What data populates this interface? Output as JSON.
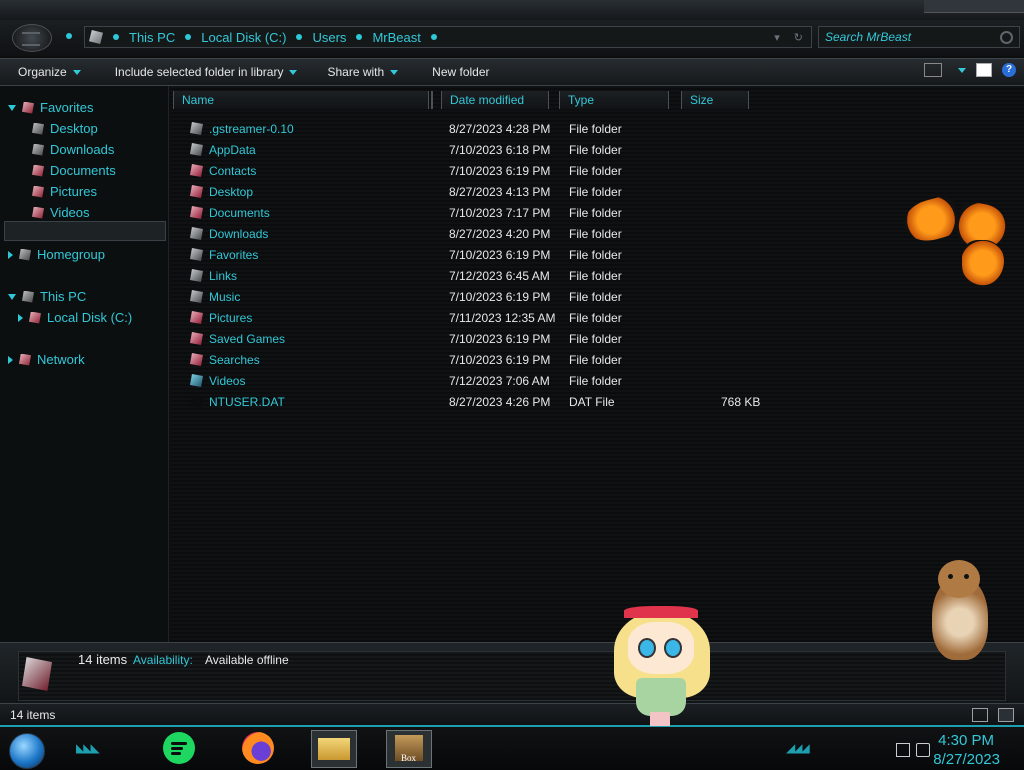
{
  "address": {
    "breadcrumbs": [
      "This PC",
      "Local Disk (C:)",
      "Users",
      "MrBeast"
    ],
    "search_placeholder": "Search MrBeast"
  },
  "toolbar": {
    "organize": "Organize",
    "include_library": "Include selected folder in library",
    "share_with": "Share with",
    "new_folder": "New folder"
  },
  "nav": {
    "favorites": "Favorites",
    "favorites_items": [
      "Desktop",
      "Downloads",
      "Documents",
      "Pictures",
      "Videos"
    ],
    "homegroup": "Homegroup",
    "this_pc": "This PC",
    "local_disk": "Local Disk (C:)",
    "network": "Network"
  },
  "columns": {
    "name": "Name",
    "date_modified": "Date modified",
    "type": "Type",
    "size": "Size"
  },
  "files": [
    {
      "name": ".gstreamer-0.10",
      "date": "8/27/2023 4:28 PM",
      "type": "File folder",
      "size": ""
    },
    {
      "name": "AppData",
      "date": "7/10/2023 6:18 PM",
      "type": "File folder",
      "size": ""
    },
    {
      "name": "Contacts",
      "date": "7/10/2023 6:19 PM",
      "type": "File folder",
      "size": ""
    },
    {
      "name": "Desktop",
      "date": "8/27/2023 4:13 PM",
      "type": "File folder",
      "size": ""
    },
    {
      "name": "Documents",
      "date": "7/10/2023 7:17 PM",
      "type": "File folder",
      "size": ""
    },
    {
      "name": "Downloads",
      "date": "8/27/2023 4:20 PM",
      "type": "File folder",
      "size": ""
    },
    {
      "name": "Favorites",
      "date": "7/10/2023 6:19 PM",
      "type": "File folder",
      "size": ""
    },
    {
      "name": "Links",
      "date": "7/12/2023 6:45 AM",
      "type": "File folder",
      "size": ""
    },
    {
      "name": "Music",
      "date": "7/10/2023 6:19 PM",
      "type": "File folder",
      "size": ""
    },
    {
      "name": "Pictures",
      "date": "7/11/2023 12:35 AM",
      "type": "File folder",
      "size": ""
    },
    {
      "name": "Saved Games",
      "date": "7/10/2023 6:19 PM",
      "type": "File folder",
      "size": ""
    },
    {
      "name": "Searches",
      "date": "7/10/2023 6:19 PM",
      "type": "File folder",
      "size": ""
    },
    {
      "name": "Videos",
      "date": "7/12/2023 7:06 AM",
      "type": "File folder",
      "size": ""
    },
    {
      "name": "NTUSER.DAT",
      "date": "8/27/2023 4:26 PM",
      "type": "DAT File",
      "size": "768 KB"
    }
  ],
  "details": {
    "count": "14 items",
    "availability_label": "Availability:",
    "availability_value": "Available offline"
  },
  "status": {
    "count": "14 items"
  },
  "taskbar": {
    "box_label": "Box",
    "time": "4:30 PM",
    "date": "8/27/2023"
  },
  "colors": {
    "accent": "#33c8d8",
    "background": "#0b0d0e"
  }
}
